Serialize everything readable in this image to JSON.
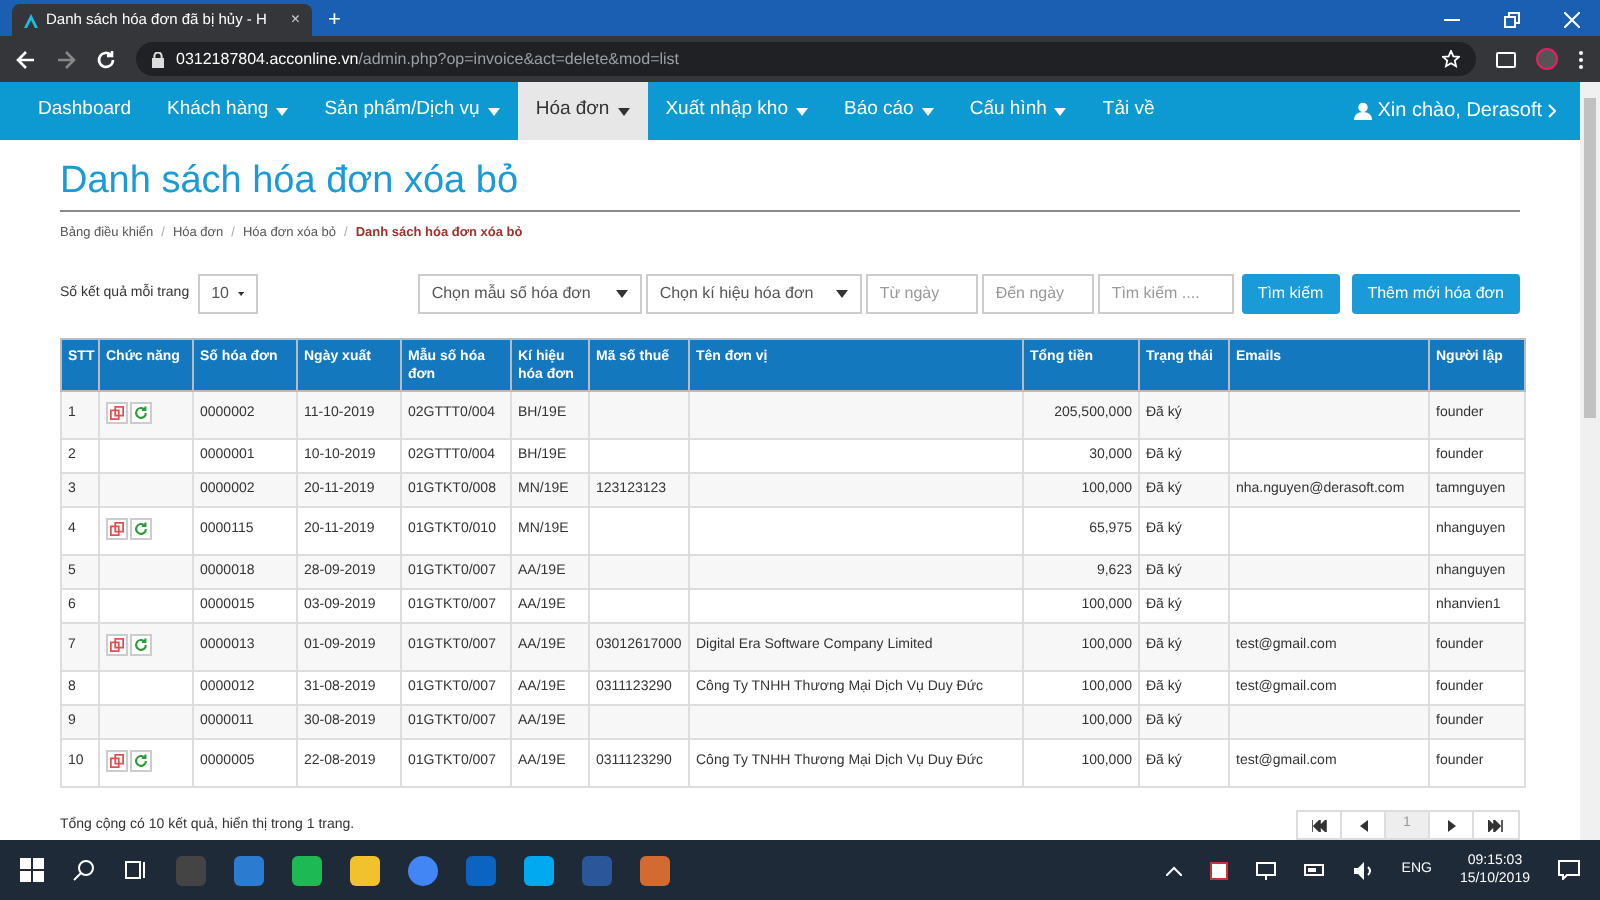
{
  "browser": {
    "tab_title": "Danh sách hóa đơn đã bị hủy - H",
    "tab_close": "×",
    "new_tab": "+",
    "url_host": "0312187804.acconline.vn",
    "url_path": "/admin.php?op=invoice&act=delete&mod=list"
  },
  "nav": {
    "items": [
      {
        "label": "Dashboard",
        "dropdown": false,
        "selected": false
      },
      {
        "label": "Khách hàng",
        "dropdown": true,
        "selected": false
      },
      {
        "label": "Sản phẩm/Dịch vụ",
        "dropdown": true,
        "selected": false
      },
      {
        "label": "Hóa đơn",
        "dropdown": true,
        "selected": true
      },
      {
        "label": "Xuất nhập kho",
        "dropdown": true,
        "selected": false
      },
      {
        "label": "Báo cáo",
        "dropdown": true,
        "selected": false
      },
      {
        "label": "Cấu hình",
        "dropdown": true,
        "selected": false
      },
      {
        "label": "Tải về",
        "dropdown": false,
        "selected": false
      }
    ],
    "user": "Xin chào, Derasoft"
  },
  "page_title": "Danh sách hóa đơn xóa bỏ",
  "breadcrumb_separator": "/",
  "breadcrumb": [
    "Bảng điều khiển",
    "Hóa đơn",
    "Hóa đơn xóa bỏ",
    "Danh sách hóa đơn xóa bỏ"
  ],
  "filters": {
    "page_size_label": "Số kết quả mỗi trang",
    "page_size": "10",
    "template_select": "Chọn mẫu số hóa đơn",
    "symbol_select": "Chọn kí hiệu hóa đơn",
    "from_date": {
      "placeholder": "Từ ngày"
    },
    "to_date": {
      "placeholder": "Đến ngày"
    },
    "search": {
      "placeholder": "Tìm kiếm ...."
    },
    "search_button": "Tìm kiếm",
    "add_button": "Thêm mới hóa đơn"
  },
  "table": {
    "columns": [
      "STT",
      "Chức năng",
      "Số hóa đơn",
      "Ngày xuất",
      "Mẫu số hóa đơn",
      "Kí hiệu hóa đơn",
      "Mã số thuế",
      "Tên đơn vị",
      "Tổng tiền",
      "Trạng thái",
      "Emails",
      "Người lập"
    ],
    "rows": [
      {
        "cells": [
          "1",
          "",
          "0000002",
          "11-10-2019",
          "02GTTT0/004",
          "BH/19E",
          "",
          "",
          "205,500,000",
          "Đã ký",
          "",
          "founder"
        ],
        "actions": true
      },
      {
        "cells": [
          "2",
          "",
          "0000001",
          "10-10-2019",
          "02GTTT0/004",
          "BH/19E",
          "",
          "",
          "30,000",
          "Đã ký",
          "",
          "founder"
        ],
        "actions": false
      },
      {
        "cells": [
          "3",
          "",
          "0000002",
          "20-11-2019",
          "01GTKT0/008",
          "MN/19E",
          "123123123",
          "",
          "100,000",
          "Đã ký",
          "nha.nguyen@derasoft.com",
          "tamnguyen"
        ],
        "actions": false
      },
      {
        "cells": [
          "4",
          "",
          "0000115",
          "20-11-2019",
          "01GTKT0/010",
          "MN/19E",
          "",
          "",
          "65,975",
          "Đã ký",
          "",
          "nhanguyen"
        ],
        "actions": true
      },
      {
        "cells": [
          "5",
          "",
          "0000018",
          "28-09-2019",
          "01GTKT0/007",
          "AA/19E",
          "",
          "",
          "9,623",
          "Đã ký",
          "",
          "nhanguyen"
        ],
        "actions": false
      },
      {
        "cells": [
          "6",
          "",
          "0000015",
          "03-09-2019",
          "01GTKT0/007",
          "AA/19E",
          "",
          "",
          "100,000",
          "Đã ký",
          "",
          "nhanvien1"
        ],
        "actions": false
      },
      {
        "cells": [
          "7",
          "",
          "0000013",
          "01-09-2019",
          "01GTKT0/007",
          "AA/19E",
          "03012617000",
          "Digital Era Software Company Limited",
          "100,000",
          "Đã ký",
          "test@gmail.com",
          "founder"
        ],
        "actions": true
      },
      {
        "cells": [
          "8",
          "",
          "0000012",
          "31-08-2019",
          "01GTKT0/007",
          "AA/19E",
          "0311123290",
          "Công Ty TNHH Thương Mại Dịch Vụ Duy Đức",
          "100,000",
          "Đã ký",
          "test@gmail.com",
          "founder"
        ],
        "actions": false
      },
      {
        "cells": [
          "9",
          "",
          "0000011",
          "30-08-2019",
          "01GTKT0/007",
          "AA/19E",
          "",
          "",
          "100,000",
          "Đã ký",
          "",
          "founder"
        ],
        "actions": false
      },
      {
        "cells": [
          "10",
          "",
          "0000005",
          "22-08-2019",
          "01GTKT0/007",
          "AA/19E",
          "0311123290",
          "Công Ty TNHH Thương Mại Dịch Vụ Duy Đức",
          "100,000",
          "Đã ký",
          "test@gmail.com",
          "founder"
        ],
        "actions": true
      }
    ]
  },
  "summary": "Tổng cộng có 10 kết quả, hiển thị trong 1 trang.",
  "pagination": {
    "pages": [
      {
        "label": "1",
        "selected": true
      }
    ]
  },
  "taskbar": {
    "language": "ENG",
    "time": "09:15:03",
    "date": "15/10/2019"
  }
}
